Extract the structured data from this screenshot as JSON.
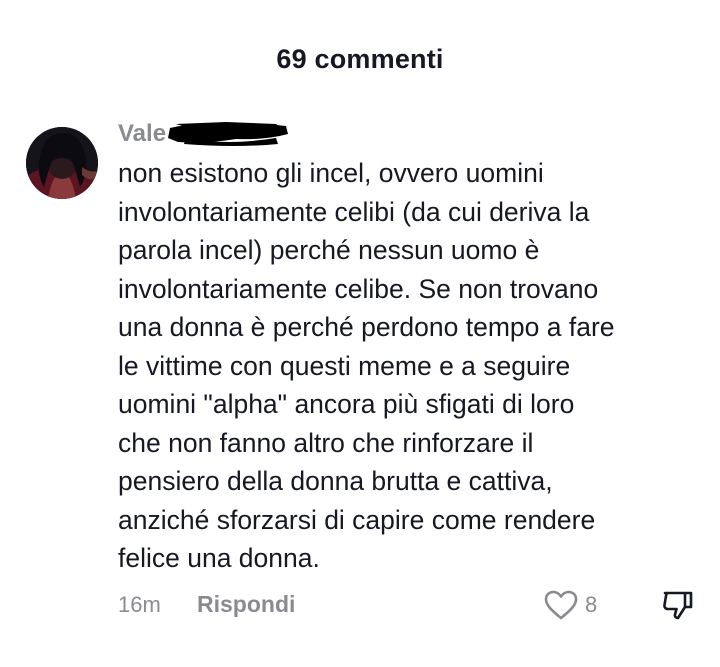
{
  "header": {
    "title": "69 commenti"
  },
  "comment": {
    "username": "Vale",
    "text": "non esistono gli incel, ovvero uomini\ninvolontariamente celibi (da cui deriva la\nparola incel) perché nessun uomo è\ninvolontariamente celibe. Se non trovano\nuna donna è perché perdono tempo a fare\nle vittime con questi meme e a seguire\nuomini \"alpha\" ancora più sfigati di loro\nche non fanno altro che rinforzare il\npensiero della donna brutta e cattiva,\nanziché sforzarsi di capire come rendere\nfelice una donna.",
    "time": "16m",
    "reply_label": "Rispondi",
    "like_count": "8",
    "icons": {
      "like": "heart-outline-icon",
      "dislike": "thumbs-down-icon"
    }
  },
  "colors": {
    "text_primary": "#161823",
    "text_secondary": "#8a8b91",
    "redaction": "#000000",
    "background": "#ffffff"
  }
}
